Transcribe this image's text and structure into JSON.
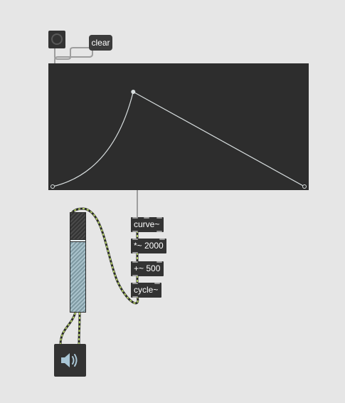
{
  "patch": {
    "bang": {
      "icon": "bang-icon"
    },
    "clear_message": {
      "label": "clear"
    },
    "function": {
      "points": [
        {
          "x": 0.0,
          "y": 0.0
        },
        {
          "x": 0.32,
          "y": 1.0
        },
        {
          "x": 1.0,
          "y": 0.0
        }
      ]
    },
    "objects": [
      {
        "name": "curve-object",
        "text": "curve~"
      },
      {
        "name": "multiply-object",
        "text": "*~ 2000"
      },
      {
        "name": "add-object",
        "text": "+~ 500"
      },
      {
        "name": "cycle-object",
        "text": "cycle~"
      }
    ],
    "gain_slider": {
      "level": 0.7
    },
    "dac": {
      "icon": "speaker-icon"
    },
    "colors": {
      "background": "#e6e6e6",
      "object_fill": "#333333",
      "signal_cord": "#b3cf66",
      "control_cord": "#9e9e9e",
      "function_line": "#d8dedf"
    }
  }
}
